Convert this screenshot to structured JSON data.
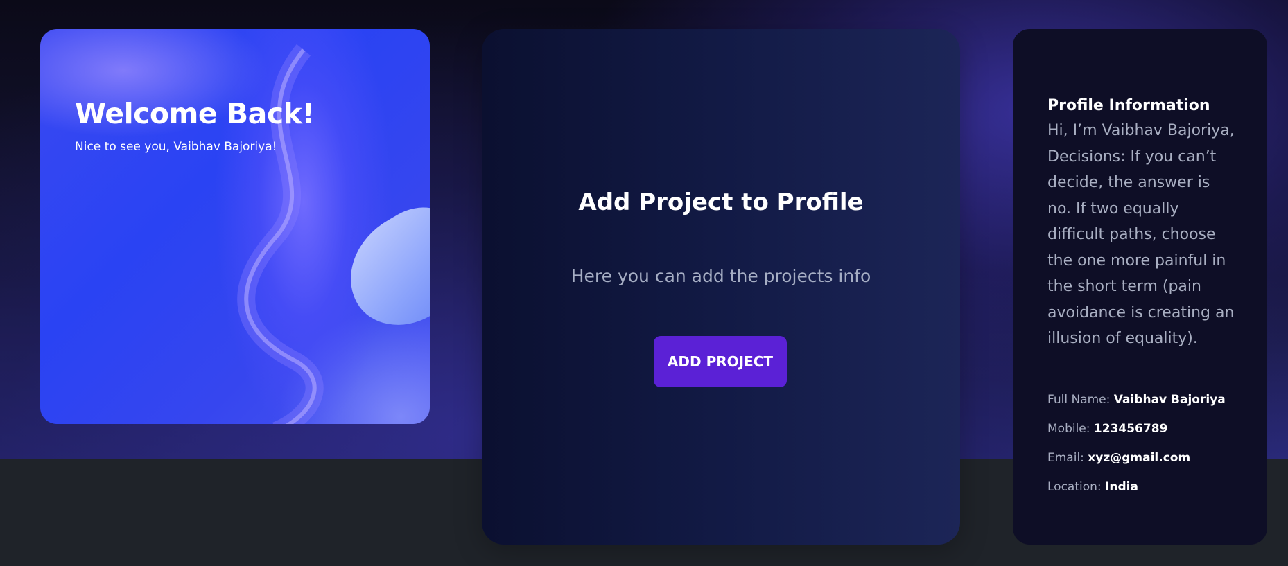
{
  "welcome": {
    "title": "Welcome Back!",
    "subtitle": "Nice to see you, Vaibhav Bajoriya!"
  },
  "project": {
    "title": "Add Project to Profile",
    "description": "Here you can add the projects info",
    "button_label": "ADD PROJECT"
  },
  "profile": {
    "title": "Profile Information",
    "bio": "Hi, I’m Vaibhav Bajoriya, Decisions: If you can’t decide, the answer is no. If two equally difficult paths, choose the one more painful in the short term (pain avoidance is creating an illusion of equality).",
    "fields": [
      {
        "label": "Full Name:",
        "value": "Vaibhav Bajoriya"
      },
      {
        "label": "Mobile:",
        "value": "123456789"
      },
      {
        "label": "Email:",
        "value": "xyz@gmail.com"
      },
      {
        "label": "Location:",
        "value": "India"
      }
    ]
  },
  "colors": {
    "accent_button": "#5b21d6",
    "welcome_card_blue": "#2a43f3",
    "profile_card_bg": "#0e0e26",
    "page_bottom": "#1f2329"
  }
}
